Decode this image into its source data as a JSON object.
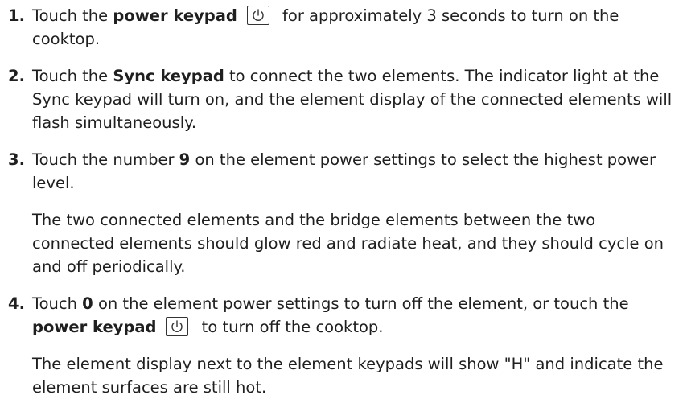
{
  "steps": [
    {
      "number": "1.",
      "pre": "Touch the ",
      "bold": "power keypad",
      "post": " for approximately 3 seconds to turn on the cooktop."
    },
    {
      "number": "2.",
      "pre": "Touch the ",
      "bold": "Sync keypad",
      "post": " to connect the two elements. The indicator light at the Sync keypad will turn on, and the element display of the connected elements will flash simultaneously."
    },
    {
      "number": "3.",
      "pre": "Touch the number ",
      "bold": "9",
      "post": " on the element power settings to select the highest power level.",
      "note": "The two connected elements and the bridge elements between the two connected elements should glow red and radiate heat, and they should cycle on and off periodically."
    },
    {
      "number": "4.",
      "pre": "Touch ",
      "bold": "0",
      "mid": " on the element power settings to turn off the element, or touch the ",
      "bold2": "power keypad",
      "post": " to turn off the cooktop.",
      "note": "The element display next to the element keypads will show \"H\" and indicate the element surfaces are still hot."
    }
  ],
  "icons": {
    "power": "power-icon"
  }
}
